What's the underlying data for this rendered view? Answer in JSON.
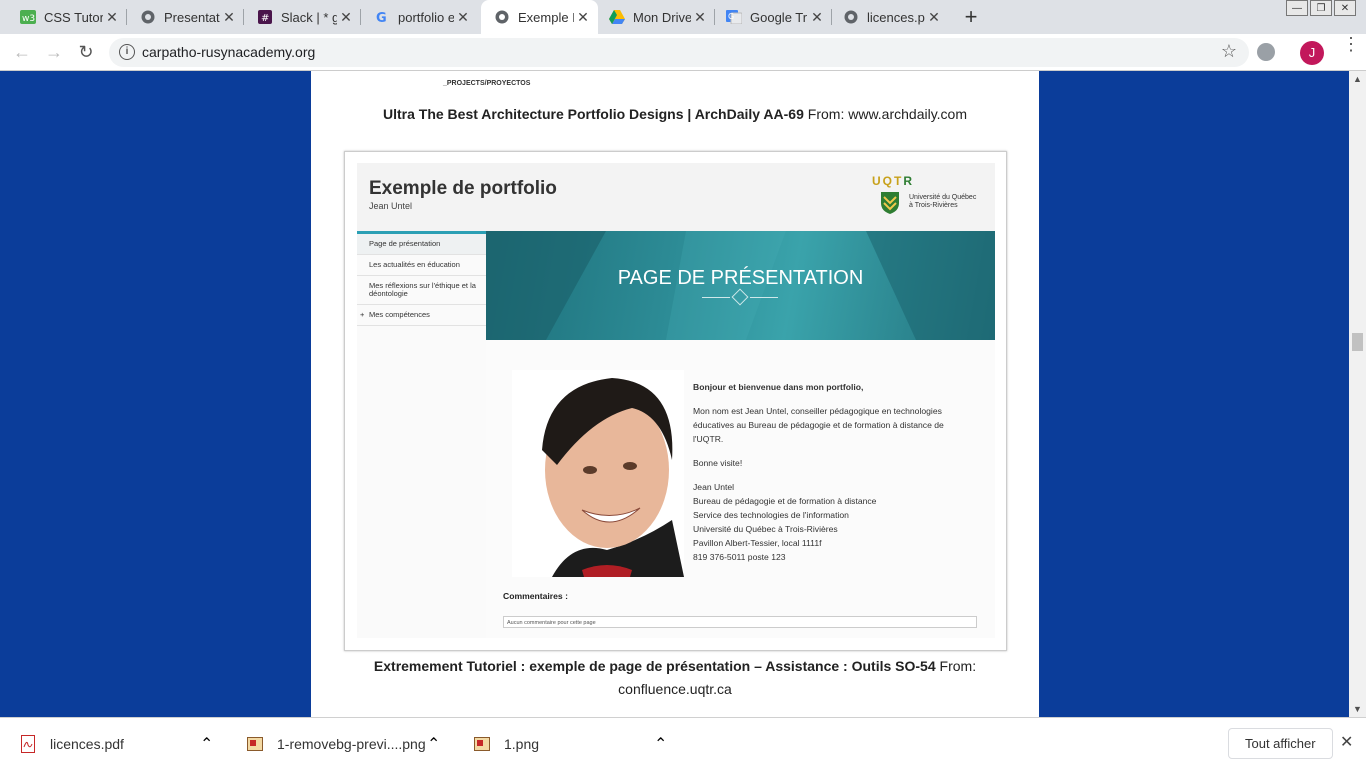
{
  "tabs": [
    {
      "title": "CSS Tutor",
      "icon": "w3schools-icon",
      "close": "✕"
    },
    {
      "title": "Presentati",
      "icon": "globe-icon",
      "close": "✕"
    },
    {
      "title": "Slack | * g",
      "icon": "slack-icon",
      "close": "✕"
    },
    {
      "title": "portfolio e",
      "icon": "google-icon",
      "close": "✕"
    },
    {
      "title": "Exemple D",
      "icon": "globe-icon",
      "close": "✕",
      "active": true
    },
    {
      "title": "Mon Drive",
      "icon": "drive-icon",
      "close": "✕"
    },
    {
      "title": "Google Tr",
      "icon": "translate-icon",
      "close": "✕"
    },
    {
      "title": "licences.p",
      "icon": "globe-icon",
      "close": "✕"
    }
  ],
  "newtab": "+",
  "window_controls": {
    "minimize": "—",
    "restore": "❐",
    "close": "✕"
  },
  "toolbar": {
    "back": "←",
    "forward": "→",
    "reload": "↻",
    "info": "i",
    "url": "carpatho-rusynacademy.org",
    "star": "☆",
    "avatar_letter": "J",
    "menu": "⋮"
  },
  "page": {
    "crumb": "_PROJECTS/PROYECTOS",
    "caption1_bold": "Ultra The Best Architecture Portfolio Designs | ArchDaily AA-69",
    "caption1_from": " From: www.archdaily.com",
    "caption2_bold": "Extremement Tutoriel : exemple de page de présentation – Assistance : Outils SO-54",
    "caption2_from": " From: confluence.uqtr.ca"
  },
  "portfolio": {
    "title": "Exemple de portfolio",
    "author": "Jean Untel",
    "logo_word_1": "UQT",
    "logo_word_2": "R",
    "logo_line1": "Université du Québec",
    "logo_line2": "à Trois-Rivières",
    "nav": [
      "Page de présentation",
      "Les actualités en éducation",
      "Mes réflexions sur l'éthique et la déontologie",
      "Mes compétences"
    ],
    "nav_plus": "+",
    "banner": "PAGE DE PRÉSENTATION",
    "greeting": "Bonjour et bienvenue dans mon portfolio,",
    "intro": "Mon nom est Jean Untel, conseiller pédagogique en technologies éducatives au Bureau de pédagogie et de formation à distance de l'UQTR.",
    "visit": "Bonne visite!",
    "sig": [
      "Jean Untel",
      "Bureau de pédagogie et de formation à distance",
      "Service des technologies de l'information",
      "Université du Québec à Trois-Rivières",
      "Pavillon Albert-Tessier, local 1111f",
      "819 376-5011 poste 123"
    ],
    "comments_label": "Commentaires :",
    "comments_placeholder": "Aucun commentaire pour cette page"
  },
  "downloads": [
    {
      "name": "licences.pdf",
      "icon": "pdf-icon"
    },
    {
      "name": "1-removebg-previ....png",
      "icon": "image-file-icon"
    },
    {
      "name": "1.png",
      "icon": "image-file-icon"
    }
  ],
  "download_chevron": "⌃",
  "show_all": "Tout afficher",
  "close_downloads": "✕",
  "colors": {
    "page_bg": "#0b3d9a",
    "tab_strip": "#dee1e6",
    "banner": "#2e8e98",
    "avatar": "#c2185b"
  }
}
